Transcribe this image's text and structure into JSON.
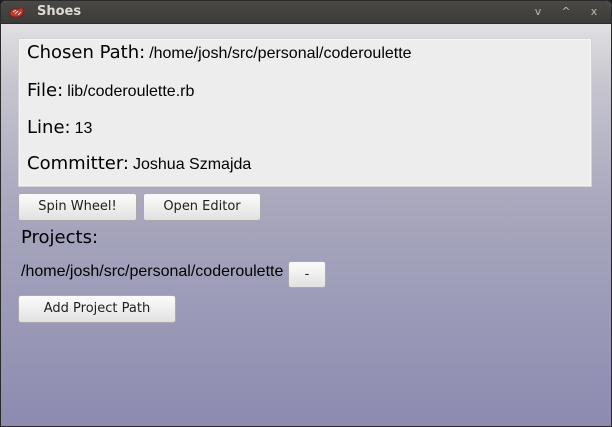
{
  "window": {
    "title": "Shoes",
    "controls": [
      "v",
      "^",
      "x"
    ]
  },
  "info": {
    "chosen_path_label": "Chosen Path:",
    "chosen_path_value": "/home/josh/src/personal/coderoulette",
    "file_label": "File:",
    "file_value": "lib/coderoulette.rb",
    "line_label": "Line:",
    "line_value": "13",
    "committer_label": "Committer:",
    "committer_value": "Joshua Szmajda"
  },
  "actions": {
    "spin_label": "Spin Wheel!",
    "open_editor_label": "Open Editor"
  },
  "projects": {
    "heading": "Projects:",
    "items": [
      {
        "path": "/home/josh/src/personal/coderoulette",
        "remove_label": "-"
      }
    ],
    "add_label": "Add Project Path"
  },
  "icons": {
    "app": "shoes-app-icon",
    "minimize": "minimize-icon",
    "maximize": "maximize-icon",
    "close": "close-icon"
  },
  "colors": {
    "titlebar": "#3c3b37",
    "title_text": "#dfdbd2",
    "info_box": "#ededed",
    "background_top": "#eaeaea",
    "background_bottom": "#8c8bb0"
  }
}
